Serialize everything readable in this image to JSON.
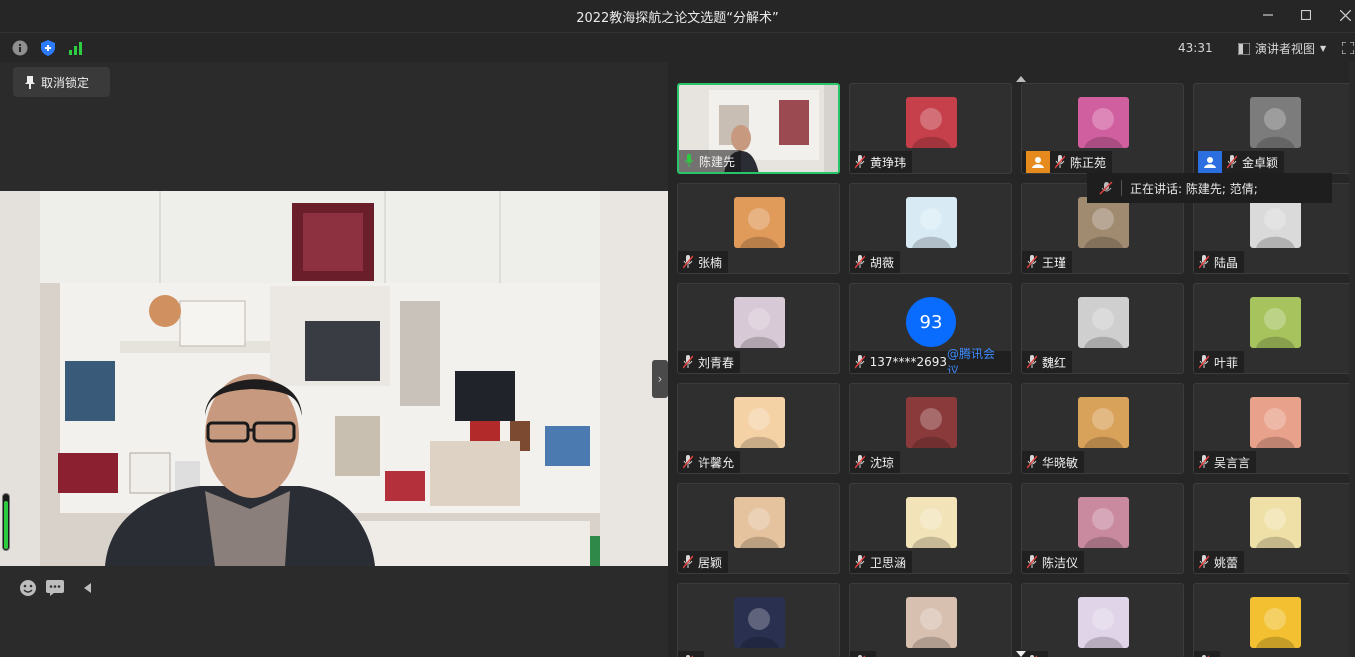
{
  "window": {
    "title": "2022教海探航之论文选题“分解术”"
  },
  "toolbar": {
    "icons": [
      "info-icon",
      "shield-icon",
      "signal-icon"
    ],
    "timer": "43:31",
    "view_label": "演讲者视图"
  },
  "main": {
    "unpin_label": "取消锁定",
    "mic_level": 0.85,
    "bottom_icons": [
      "emoji-icon",
      "chat-icon",
      "collapse-icon"
    ]
  },
  "speaking": {
    "text": "正在讲话: 陈建先; 范倩;"
  },
  "participants": [
    {
      "name": "陈建先",
      "avatar": "camera",
      "color": "#8a8f93",
      "active": true
    },
    {
      "name": "黄琤玮",
      "avatar": "red-hood",
      "color": "#c5404a"
    },
    {
      "name": "陈正苑",
      "avatar": "cartoon",
      "color": "#d05fa0",
      "host": "orange"
    },
    {
      "name": "金卓颖",
      "avatar": "anime-girl",
      "color": "#7c7c7c",
      "host": "blue"
    },
    {
      "name": "张楠",
      "avatar": "sunset",
      "color": "#e09a5a"
    },
    {
      "name": "胡薇",
      "avatar": "doodle",
      "color": "#d8ebf5"
    },
    {
      "name": "王瑾",
      "avatar": "photo",
      "color": "#a08a70"
    },
    {
      "name": "陆晶",
      "avatar": "woman",
      "color": "#dadada"
    },
    {
      "name": "刘青春",
      "avatar": "pastel",
      "color": "#d7c9d6"
    },
    {
      "name": "137****2693",
      "suffix": "@腾讯会议",
      "avatar_num": "93"
    },
    {
      "name": "魏红",
      "avatar": "cup",
      "color": "#cfcfcf"
    },
    {
      "name": "叶菲",
      "avatar": "flower",
      "color": "#a6c35e"
    },
    {
      "name": "许馨允",
      "avatar": "chibi",
      "color": "#f5d2a6"
    },
    {
      "name": "沈琼",
      "avatar": "train",
      "color": "#8a3a3a"
    },
    {
      "name": "华晓敏",
      "avatar": "desert",
      "color": "#d9a25a"
    },
    {
      "name": "吴言言",
      "avatar": "baby",
      "color": "#e8a18a"
    },
    {
      "name": "居颖",
      "avatar": "cat-fa",
      "color": "#e5c39e"
    },
    {
      "name": "卫思涵",
      "avatar": "drink",
      "color": "#f2e3b8"
    },
    {
      "name": "陈洁仪",
      "avatar": "anime",
      "color": "#c98aa0"
    },
    {
      "name": "姚蕾",
      "avatar": "cartoon-face",
      "color": "#efe0a8"
    },
    {
      "name": "",
      "avatar": "night",
      "color": "#2a3050"
    },
    {
      "name": "",
      "avatar": "pet",
      "color": "#d8c0b0"
    },
    {
      "name": "",
      "avatar": "cat",
      "color": "#e0d4e8"
    },
    {
      "name": "",
      "avatar": "chestnut",
      "color": "#f2c030"
    }
  ],
  "colors": {
    "accent": "#29c36a",
    "brand_blue": "#0a6cff"
  }
}
